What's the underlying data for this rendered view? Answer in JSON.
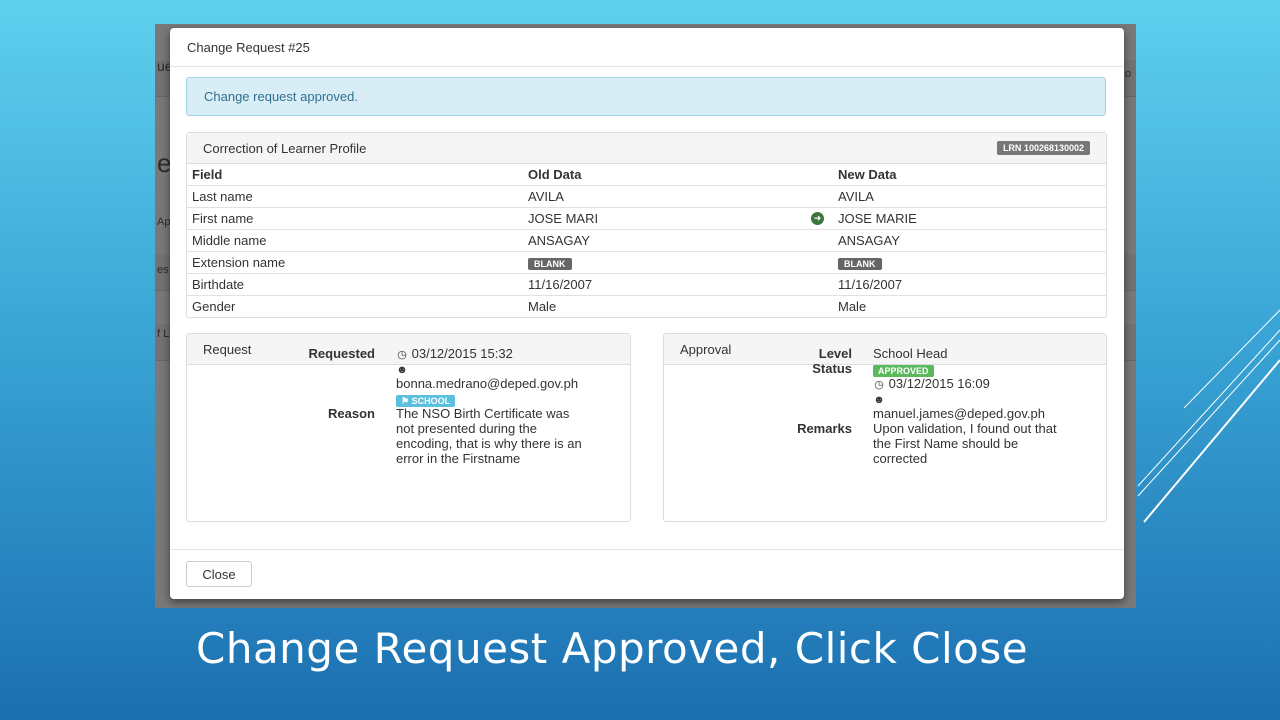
{
  "modal": {
    "title": "Change Request #25",
    "alert": "Change request approved.",
    "close_label": "Close"
  },
  "background_fragments": [
    "ue",
    "e",
    "Ap",
    "es",
    "f L",
    "o"
  ],
  "profile": {
    "heading": "Correction of Learner Profile",
    "lrn_badge": "LRN 100268130002",
    "columns": [
      "Field",
      "Old Data",
      "New Data"
    ],
    "rows": [
      {
        "field": "Last name",
        "old": "AVILA",
        "new": "AVILA"
      },
      {
        "field": "First name",
        "old": "JOSE MARI",
        "new": "JOSE MARIE"
      },
      {
        "field": "Middle name",
        "old": "ANSAGAY",
        "new": "ANSAGAY"
      },
      {
        "field": "Extension name",
        "old": "BLANK",
        "new": "BLANK"
      },
      {
        "field": "Birthdate",
        "old": "11/16/2007",
        "new": "11/16/2007"
      },
      {
        "field": "Gender",
        "old": "Male",
        "new": "Male"
      }
    ]
  },
  "request": {
    "heading": "Request",
    "requested_label": "Requested",
    "requested_time": "03/12/2015 15:32",
    "requester_email": "bonna.medrano@deped.gov.ph",
    "requester_badge": "SCHOOL",
    "reason_label": "Reason",
    "reason_lines": [
      "The NSO Birth Certificate was",
      "not presented during the",
      "encoding, that is why there is an",
      "error in the Firstname"
    ]
  },
  "approval": {
    "heading": "Approval",
    "level_label": "Level",
    "level_value": "School Head",
    "status_label": "Status",
    "status_badge": "APPROVED",
    "approved_time": "03/12/2015 16:09",
    "approver_email": "manuel.james@deped.gov.ph",
    "remarks_label": "Remarks",
    "remarks_lines": [
      "Upon validation, I found out that",
      "the First Name should be",
      "corrected"
    ]
  },
  "slide_caption": "Change Request Approved, Click Close",
  "colors": {
    "alert_bg": "#d9edf7",
    "approved": "#5cb85c",
    "school": "#5bc0de",
    "changed_arrow": "#3c763d"
  }
}
